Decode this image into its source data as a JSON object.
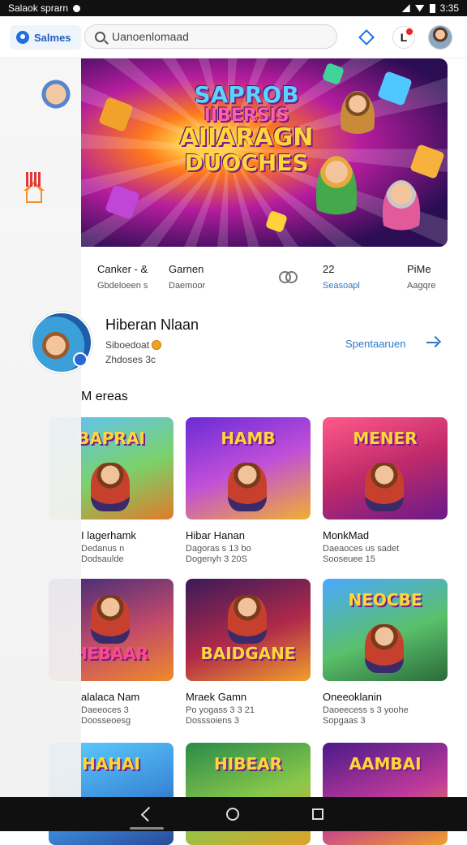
{
  "status_bar": {
    "left_text": "Salaok sprarn",
    "time": "3:35"
  },
  "header": {
    "brand_label": "Salmes",
    "search": {
      "value": "",
      "placeholder": "Uanoenlomaad"
    },
    "notification_label": "L",
    "icons": [
      "diamond-icon",
      "notification-icon",
      "avatar"
    ]
  },
  "sidebar": {
    "icons": [
      "avatar",
      "home-icon",
      "bars-icon"
    ]
  },
  "hero": {
    "lines": [
      "SAPROB",
      "IIBERSIS",
      "AIIARAGN",
      "DUOCHES"
    ]
  },
  "stats": [
    {
      "title": "Canker - &",
      "subtitle": "Gbdeloeen s"
    },
    {
      "title": "Garnen",
      "subtitle": "Daemoor"
    },
    {
      "title": "22",
      "subtitle": "Seasoapl"
    },
    {
      "title": "PiMe",
      "subtitle": "Aagqre"
    }
  ],
  "creator": {
    "name": "Hiberan Nlaan",
    "meta_line1": "Siboedoat",
    "meta_line2": "Zhdoses 3c",
    "link_label": "Spentaaruen"
  },
  "section_title": "M ereas",
  "games": [
    {
      "thumb_text": "BAPRAI",
      "title": "I lagerhamk",
      "sub1": "Dedanus n",
      "sub2": "Dodsaulde"
    },
    {
      "thumb_text": "HAMB",
      "title": "Hibar Hanan",
      "sub1": "Dagoras s 13 bo",
      "sub2": "Dogenyh 3 20S"
    },
    {
      "thumb_text": "MENER",
      "title": "MonkMad",
      "sub1": "Daeaoces us sadet",
      "sub2": "Sooseuee 15"
    },
    {
      "thumb_text": "HEBAAR",
      "title": "alalaca Nam",
      "sub1": "Daeeoces 3",
      "sub2": "Doosseoesg"
    },
    {
      "thumb_text": "BAIDGANE",
      "title": "Mraek Gamn",
      "sub1": "Po yogass 3 3 21",
      "sub2": "Dosssoiens 3"
    },
    {
      "thumb_text": "NEOCBE",
      "title": "Oneeoklanin",
      "sub1": "Daoeecess s 3 yoohe",
      "sub2": "Sopgaas 3"
    },
    {
      "thumb_text": "HAHAI",
      "title": "",
      "sub1": "",
      "sub2": ""
    },
    {
      "thumb_text": "HIBEAR",
      "title": "",
      "sub1": "",
      "sub2": ""
    },
    {
      "thumb_text": "AAMBAI",
      "title": "",
      "sub1": "",
      "sub2": ""
    }
  ],
  "colors": {
    "accent": "#1e6fe0",
    "link": "#2a79c9",
    "badge": "#e22a2a"
  }
}
